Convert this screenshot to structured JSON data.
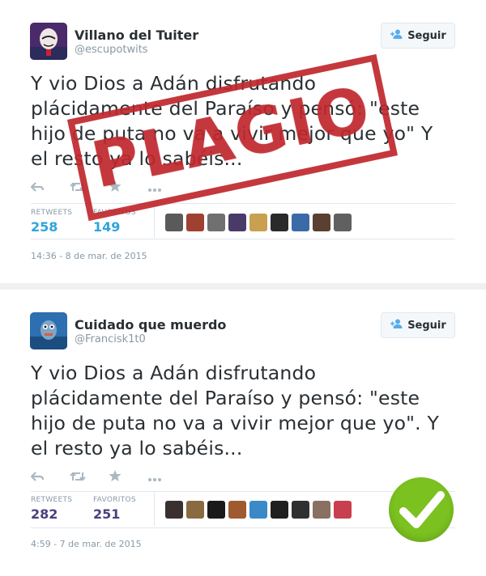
{
  "tweets": [
    {
      "name": "Villano del Tuiter",
      "handle": "@escupotwits",
      "follow_label": "Seguir",
      "text": "Y vio Dios a Adán disfrutando plácidamente del Paraíso y pensó: \"este hijo de puta no va a vivir mejor que yo\" Y el resto ya lo sabéis...",
      "retweets_label": "RETWEETS",
      "retweets": "258",
      "favorites_label": "FAVORITOS",
      "favorites": "149",
      "timestamp": "14:36 - 8 de mar. de 2015",
      "stamp": "PLAGIO",
      "count_color": "#2fa4dc"
    },
    {
      "name": "Cuidado que muerdo",
      "handle": "@Francisk1t0",
      "follow_label": "Seguir",
      "text": "Y vio Dios a Adán disfrutando plácidamente del Paraíso y pensó: \"este hijo de puta no va a vivir mejor que yo\". Y el resto ya lo sabéis...",
      "retweets_label": "RETWEETS",
      "retweets": "282",
      "favorites_label": "FAVORITOS",
      "favorites": "251",
      "timestamp": "4:59 - 7 de mar. de 2015",
      "count_color": "#4b3f7e"
    }
  ],
  "icons": [
    "reply-icon",
    "retweet-icon",
    "favorite-icon",
    "more-icon",
    "add-user-icon",
    "checkmark-icon"
  ],
  "colors": {
    "stamp": "#c0282d",
    "check_badge": "#7bc120",
    "muted": "#8899a6"
  }
}
